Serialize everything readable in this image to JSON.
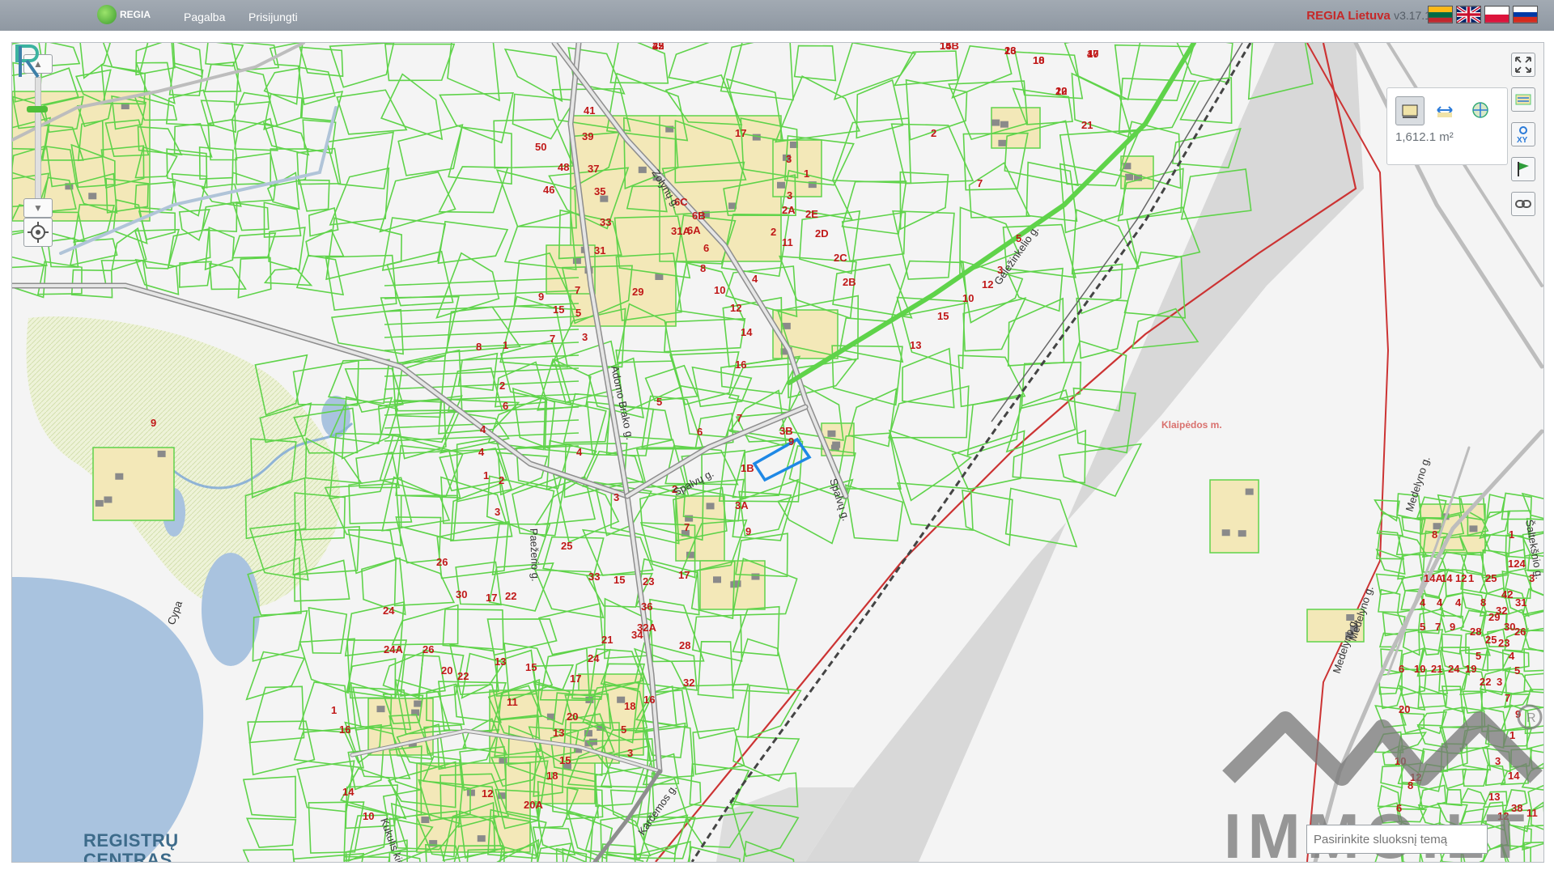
{
  "topbar": {
    "logo_text": "REGIA",
    "nav": [
      "Pagalba",
      "Prisijungti"
    ],
    "brand_name": "REGIA Lietuva",
    "version": "v3.17.1",
    "languages": [
      "lt-flag-icon",
      "en-flag-icon",
      "pl-flag-icon",
      "ru-flag-icon"
    ]
  },
  "map": {
    "area_label": "Klaipėdos m.",
    "street_labels": [
      "Zolynų g.",
      "Adomo Brako g.",
      "Spalvų g.",
      "Spalvų g.",
      "Geležinkelio g.",
      "Paežerio g.",
      "Cypa",
      "Karčemos g.",
      "Kukulis kių",
      "Medelyno g.",
      "Medelyno g.",
      "Medelyno g.",
      "Šaltekšnio g."
    ],
    "selected_parcel": "3B",
    "parcel_numbers": [
      "45",
      "47",
      "8",
      "30",
      "36",
      "15A",
      "28",
      "24",
      "38",
      "40",
      "15B",
      "26",
      "18",
      "20",
      "21",
      "41",
      "39",
      "17",
      "50",
      "48",
      "37",
      "46",
      "35",
      "33",
      "31",
      "29",
      "6C",
      "6B",
      "31A",
      "6A",
      "6",
      "8",
      "10",
      "12",
      "14",
      "16",
      "4",
      "2",
      "3",
      "1",
      "3",
      "2E",
      "2D",
      "2C",
      "2B",
      "2A",
      "2",
      "7",
      "5",
      "3",
      "12",
      "10",
      "15",
      "13",
      "11",
      "9",
      "7",
      "15",
      "5",
      "3",
      "7",
      "1",
      "8",
      "2",
      "6",
      "4",
      "4",
      "1",
      "2",
      "3",
      "4",
      "5",
      "6",
      "7",
      "9",
      "1B",
      "2",
      "3",
      "3A",
      "7",
      "9",
      "25",
      "33",
      "15",
      "23",
      "17",
      "36",
      "34",
      "32A",
      "21",
      "24",
      "28",
      "32",
      "26",
      "30",
      "17",
      "22",
      "24",
      "24A",
      "26",
      "20",
      "13",
      "15",
      "17",
      "20",
      "22",
      "11",
      "13",
      "15",
      "18",
      "20A",
      "18",
      "16",
      "5",
      "3",
      "1",
      "16",
      "14",
      "10",
      "12",
      "9",
      "8",
      "1",
      "14A",
      "14",
      "12",
      "1",
      "25",
      "124",
      "3",
      "42",
      "4",
      "4",
      "4",
      "8",
      "32",
      "31",
      "29",
      "30",
      "5",
      "7",
      "9",
      "28",
      "25",
      "26",
      "23",
      "5",
      "4",
      "6",
      "10",
      "21",
      "24",
      "19",
      "22",
      "3",
      "5",
      "7",
      "9",
      "20",
      "1",
      "3",
      "6",
      "8",
      "10",
      "12",
      "14",
      "13",
      "38",
      "12",
      "11",
      "22",
      "20",
      "16",
      "18",
      "15",
      "1",
      "4",
      "2",
      "19",
      "17",
      "14",
      "13",
      "10",
      "12"
    ]
  },
  "measure_panel": {
    "area_value": "1,612.1 m²"
  },
  "tools": [
    "fullscreen-icon",
    "layers-icon",
    "xy-coordinates-icon",
    "flag-icon",
    "link-icon"
  ],
  "search": {
    "placeholder": "Pasirinkite sluoksnį temą"
  },
  "registry_logo": {
    "line1": "REGISTRŲ",
    "line2": "CENTRAS"
  },
  "scale_bar": [
    "0",
    "50",
    "100m"
  ],
  "watermark_text": "IMMO.LT",
  "colors": {
    "parcel": "#5fd34a",
    "road": "#bdbdbd",
    "water": "#a9c3df",
    "building_lot": "#f3e8b8",
    "city_boundary": "#cc3333",
    "city_area": "#d8d8d8",
    "selection": "#1e88e5",
    "label": "#c01818"
  }
}
